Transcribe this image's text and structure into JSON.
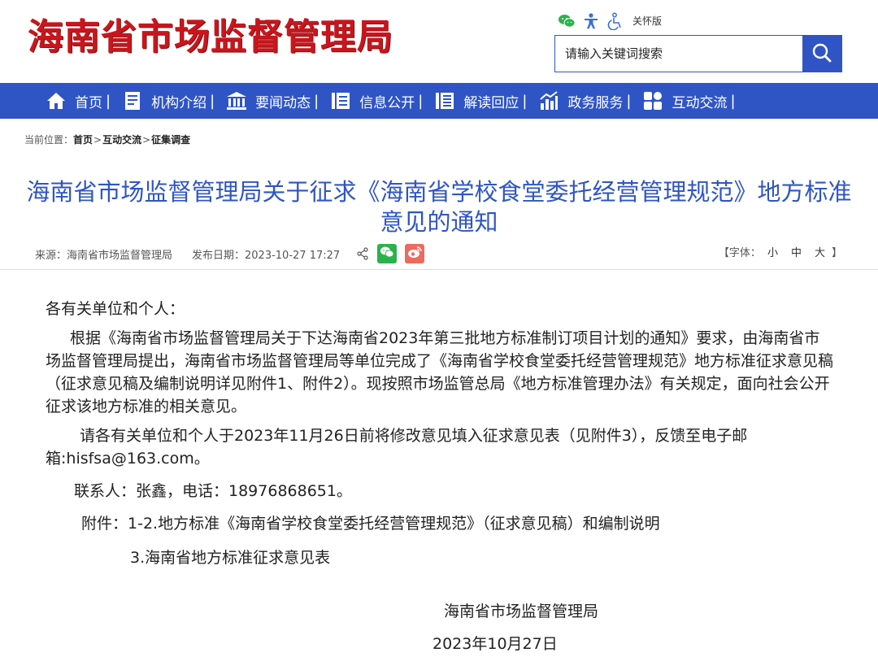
{
  "header": {
    "site_title": "海南省市场监督管理局",
    "care_mode_label": "关怀版",
    "search": {
      "placeholder": "请输入关键词搜索"
    },
    "util_icons": [
      "wechat-icon",
      "accessibility-icon",
      "elderly-care-icon"
    ]
  },
  "nav": {
    "items": [
      {
        "label": "首页",
        "icon": "home-icon"
      },
      {
        "label": "机构介绍",
        "icon": "book-icon"
      },
      {
        "label": "要闻动态",
        "icon": "building-icon"
      },
      {
        "label": "信息公开",
        "icon": "info-columns-icon"
      },
      {
        "label": "解读回应",
        "icon": "list-doc-icon"
      },
      {
        "label": "政务服务",
        "icon": "chart-icon"
      },
      {
        "label": "互动交流",
        "icon": "grid-icon"
      }
    ],
    "separator": "|"
  },
  "breadcrumb": {
    "prefix": "当前位置：",
    "items": [
      "首页",
      "互动交流",
      "征集调查"
    ],
    "separator": ">"
  },
  "article": {
    "title_line1": "海南省市场监督管理局关于征求《海南省学校食堂委托经营管理规范》地方标准",
    "title_line2": "意见的通知",
    "meta": {
      "source": "来源：海南省市场监督管理局",
      "date": "发布日期：2023-10-27 17:27",
      "font_label_open": "【字体：",
      "font_small": "小",
      "font_medium": "中",
      "font_large": "大",
      "font_label_close": "】"
    },
    "greeting": "各有关单位和个人：",
    "paragraph1": "根据《海南省市场监督管理局关于下达海南省2023年第三批地方标准制订项目计划的通知》要求，由海南省市场监督管理局提出，海南省市场监督管理局等单位完成了《海南省学校食堂委托经营管理规范》地方标准征求意见稿（征求意见稿及编制说明详见附件1、附件2）。现按照市场监管总局《地方标准管理办法》有关规定，面向社会公开征求该地方标准的相关意见。",
    "paragraph2": "请各有关单位和个人于2023年11月26日前将修改意见填入征求意见表（见附件3），反馈至电子邮箱:hisfsa@163.com。",
    "contact": "联系人：张鑫，电话：18976868651。",
    "attachment1": "附件：1-2.地方标准《海南省学校食堂委托经营管理规范》（征求意见稿）和编制说明",
    "attachment2": "3.海南省地方标准征求意见表",
    "signature_org": "海南省市场监督管理局",
    "signature_date": "2023年10月27日"
  },
  "colors": {
    "brand_red": "#c8161d",
    "brand_blue": "#2f55c5",
    "wechat_green": "#2bb24c",
    "weibo_red": "#ec6a5e"
  }
}
